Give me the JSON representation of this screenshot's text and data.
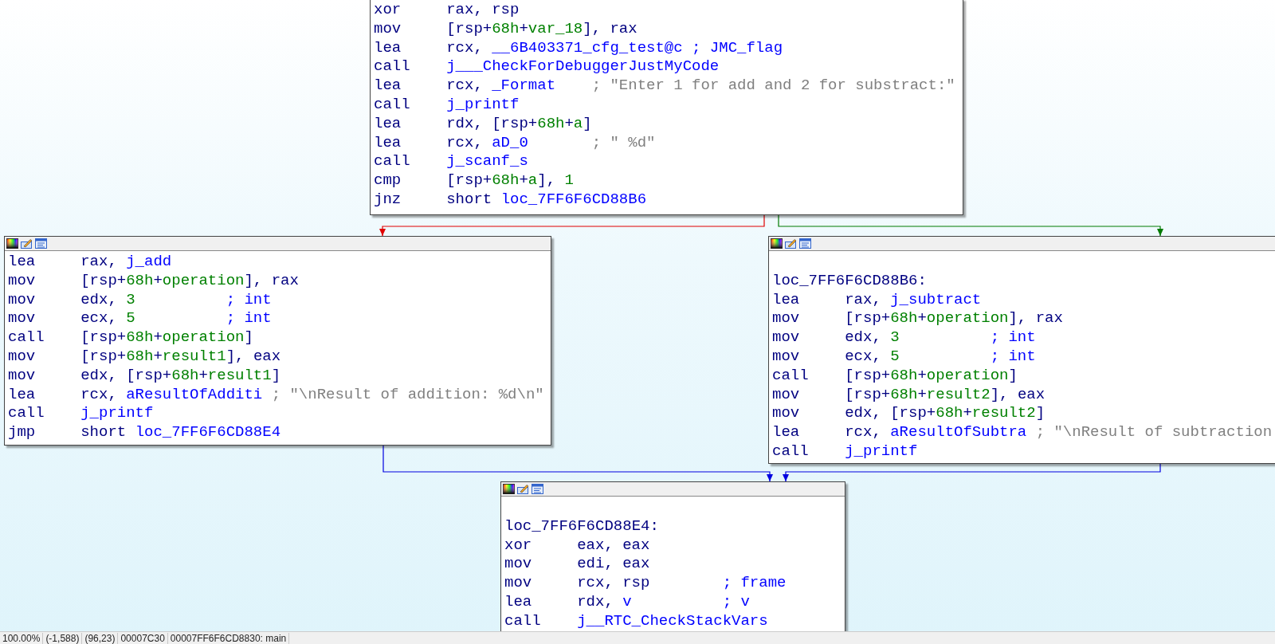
{
  "graph": {
    "blocks": [
      {
        "header": false,
        "lines": [
          {
            "mnemonic": "xor",
            "operands": [
              {
                "text": "rax, rsp",
                "kind": "op"
              }
            ]
          },
          {
            "mnemonic": "mov",
            "operands": [
              {
                "text": "[rsp+",
                "kind": "op"
              },
              {
                "text": "68h",
                "kind": "num"
              },
              {
                "text": "+",
                "kind": "op"
              },
              {
                "text": "var_18",
                "kind": "num"
              },
              {
                "text": "], rax",
                "kind": "op"
              }
            ]
          },
          {
            "mnemonic": "lea",
            "operands": [
              {
                "text": "rcx, ",
                "kind": "op"
              },
              {
                "text": "__6B403371_cfg_test@c ; JMC_flag",
                "kind": "name"
              }
            ]
          },
          {
            "mnemonic": "call",
            "operands": [
              {
                "text": "j___CheckForDebuggerJustMyCode",
                "kind": "name"
              }
            ]
          },
          {
            "mnemonic": "lea",
            "operands": [
              {
                "text": "rcx, ",
                "kind": "op"
              },
              {
                "text": "_Format",
                "kind": "name"
              },
              {
                "text": "    ; \"Enter 1 for add and 2 for substract:\"",
                "kind": "str"
              }
            ]
          },
          {
            "mnemonic": "call",
            "operands": [
              {
                "text": "j_printf",
                "kind": "name"
              }
            ]
          },
          {
            "mnemonic": "lea",
            "operands": [
              {
                "text": "rdx, [rsp+",
                "kind": "op"
              },
              {
                "text": "68h",
                "kind": "num"
              },
              {
                "text": "+",
                "kind": "op"
              },
              {
                "text": "a",
                "kind": "num"
              },
              {
                "text": "]",
                "kind": "op"
              }
            ]
          },
          {
            "mnemonic": "lea",
            "operands": [
              {
                "text": "rcx, ",
                "kind": "op"
              },
              {
                "text": "aD_0",
                "kind": "name"
              },
              {
                "text": "       ; \" %d\"",
                "kind": "str"
              }
            ]
          },
          {
            "mnemonic": "call",
            "operands": [
              {
                "text": "j_scanf_s",
                "kind": "name"
              }
            ]
          },
          {
            "mnemonic": "cmp",
            "operands": [
              {
                "text": "[rsp+",
                "kind": "op"
              },
              {
                "text": "68h",
                "kind": "num"
              },
              {
                "text": "+",
                "kind": "op"
              },
              {
                "text": "a",
                "kind": "num"
              },
              {
                "text": "], ",
                "kind": "op"
              },
              {
                "text": "1",
                "kind": "num"
              }
            ]
          },
          {
            "mnemonic": "jnz",
            "operands": [
              {
                "text": "short ",
                "kind": "op"
              },
              {
                "text": "loc_7FF6F6CD88B6",
                "kind": "name"
              }
            ]
          }
        ]
      },
      {
        "header": true,
        "lines": [
          {
            "mnemonic": "lea",
            "operands": [
              {
                "text": "rax, ",
                "kind": "op"
              },
              {
                "text": "j_add",
                "kind": "name"
              }
            ]
          },
          {
            "mnemonic": "mov",
            "operands": [
              {
                "text": "[rsp+",
                "kind": "op"
              },
              {
                "text": "68h",
                "kind": "num"
              },
              {
                "text": "+",
                "kind": "op"
              },
              {
                "text": "operation",
                "kind": "num"
              },
              {
                "text": "], rax",
                "kind": "op"
              }
            ]
          },
          {
            "mnemonic": "mov",
            "operands": [
              {
                "text": "edx, ",
                "kind": "op"
              },
              {
                "text": "3",
                "kind": "num"
              },
              {
                "text": "          ; int",
                "kind": "name"
              }
            ]
          },
          {
            "mnemonic": "mov",
            "operands": [
              {
                "text": "ecx, ",
                "kind": "op"
              },
              {
                "text": "5",
                "kind": "num"
              },
              {
                "text": "          ; int",
                "kind": "name"
              }
            ]
          },
          {
            "mnemonic": "call",
            "operands": [
              {
                "text": "[rsp+",
                "kind": "op"
              },
              {
                "text": "68h",
                "kind": "num"
              },
              {
                "text": "+",
                "kind": "op"
              },
              {
                "text": "operation",
                "kind": "num"
              },
              {
                "text": "]",
                "kind": "op"
              }
            ]
          },
          {
            "mnemonic": "mov",
            "operands": [
              {
                "text": "[rsp+",
                "kind": "op"
              },
              {
                "text": "68h",
                "kind": "num"
              },
              {
                "text": "+",
                "kind": "op"
              },
              {
                "text": "result1",
                "kind": "num"
              },
              {
                "text": "], eax",
                "kind": "op"
              }
            ]
          },
          {
            "mnemonic": "mov",
            "operands": [
              {
                "text": "edx, [rsp+",
                "kind": "op"
              },
              {
                "text": "68h",
                "kind": "num"
              },
              {
                "text": "+",
                "kind": "op"
              },
              {
                "text": "result1",
                "kind": "num"
              },
              {
                "text": "]",
                "kind": "op"
              }
            ]
          },
          {
            "mnemonic": "lea",
            "operands": [
              {
                "text": "rcx, ",
                "kind": "op"
              },
              {
                "text": "aResultOfAdditi",
                "kind": "name"
              },
              {
                "text": " ; \"\\nResult of addition: %d\\n\"",
                "kind": "str"
              }
            ]
          },
          {
            "mnemonic": "call",
            "operands": [
              {
                "text": "j_printf",
                "kind": "name"
              }
            ]
          },
          {
            "mnemonic": "jmp",
            "operands": [
              {
                "text": "short ",
                "kind": "op"
              },
              {
                "text": "loc_7FF6F6CD88E4",
                "kind": "name"
              }
            ]
          }
        ]
      },
      {
        "header": true,
        "label": "loc_7FF6F6CD88B6:",
        "lines": [
          {
            "mnemonic": "lea",
            "operands": [
              {
                "text": "rax, ",
                "kind": "op"
              },
              {
                "text": "j_subtract",
                "kind": "name"
              }
            ]
          },
          {
            "mnemonic": "mov",
            "operands": [
              {
                "text": "[rsp+",
                "kind": "op"
              },
              {
                "text": "68h",
                "kind": "num"
              },
              {
                "text": "+",
                "kind": "op"
              },
              {
                "text": "operation",
                "kind": "num"
              },
              {
                "text": "], rax",
                "kind": "op"
              }
            ]
          },
          {
            "mnemonic": "mov",
            "operands": [
              {
                "text": "edx, ",
                "kind": "op"
              },
              {
                "text": "3",
                "kind": "num"
              },
              {
                "text": "          ; int",
                "kind": "name"
              }
            ]
          },
          {
            "mnemonic": "mov",
            "operands": [
              {
                "text": "ecx, ",
                "kind": "op"
              },
              {
                "text": "5",
                "kind": "num"
              },
              {
                "text": "          ; int",
                "kind": "name"
              }
            ]
          },
          {
            "mnemonic": "call",
            "operands": [
              {
                "text": "[rsp+",
                "kind": "op"
              },
              {
                "text": "68h",
                "kind": "num"
              },
              {
                "text": "+",
                "kind": "op"
              },
              {
                "text": "operation",
                "kind": "num"
              },
              {
                "text": "]",
                "kind": "op"
              }
            ]
          },
          {
            "mnemonic": "mov",
            "operands": [
              {
                "text": "[rsp+",
                "kind": "op"
              },
              {
                "text": "68h",
                "kind": "num"
              },
              {
                "text": "+",
                "kind": "op"
              },
              {
                "text": "result2",
                "kind": "num"
              },
              {
                "text": "], eax",
                "kind": "op"
              }
            ]
          },
          {
            "mnemonic": "mov",
            "operands": [
              {
                "text": "edx, [rsp+",
                "kind": "op"
              },
              {
                "text": "68h",
                "kind": "num"
              },
              {
                "text": "+",
                "kind": "op"
              },
              {
                "text": "result2",
                "kind": "num"
              },
              {
                "text": "]",
                "kind": "op"
              }
            ]
          },
          {
            "mnemonic": "lea",
            "operands": [
              {
                "text": "rcx, ",
                "kind": "op"
              },
              {
                "text": "aResultOfSubtra",
                "kind": "name"
              },
              {
                "text": " ; \"\\nResult of subtraction",
                "kind": "str"
              }
            ]
          },
          {
            "mnemonic": "call",
            "operands": [
              {
                "text": "j_printf",
                "kind": "name"
              }
            ]
          }
        ]
      },
      {
        "header": true,
        "label": "loc_7FF6F6CD88E4:",
        "lines": [
          {
            "mnemonic": "xor",
            "operands": [
              {
                "text": "eax, eax",
                "kind": "op"
              }
            ]
          },
          {
            "mnemonic": "mov",
            "operands": [
              {
                "text": "edi, eax",
                "kind": "op"
              }
            ]
          },
          {
            "mnemonic": "mov",
            "operands": [
              {
                "text": "rcx, rsp",
                "kind": "op"
              },
              {
                "text": "        ; frame",
                "kind": "name"
              }
            ]
          },
          {
            "mnemonic": "lea",
            "operands": [
              {
                "text": "rdx, ",
                "kind": "op"
              },
              {
                "text": "v",
                "kind": "name"
              },
              {
                "text": "          ; v",
                "kind": "name"
              }
            ]
          },
          {
            "mnemonic": "call",
            "operands": [
              {
                "text": "j__RTC_CheckStackVars",
                "kind": "name"
              }
            ]
          }
        ]
      }
    ],
    "edges": [
      {
        "kind": "false"
      },
      {
        "kind": "true"
      },
      {
        "kind": "jump"
      },
      {
        "kind": "jump"
      }
    ]
  },
  "status_bar": [
    "100.00%",
    "(-1,588)",
    "(96,23)",
    "00007C30",
    "00007FF6F6CD8830: main"
  ]
}
